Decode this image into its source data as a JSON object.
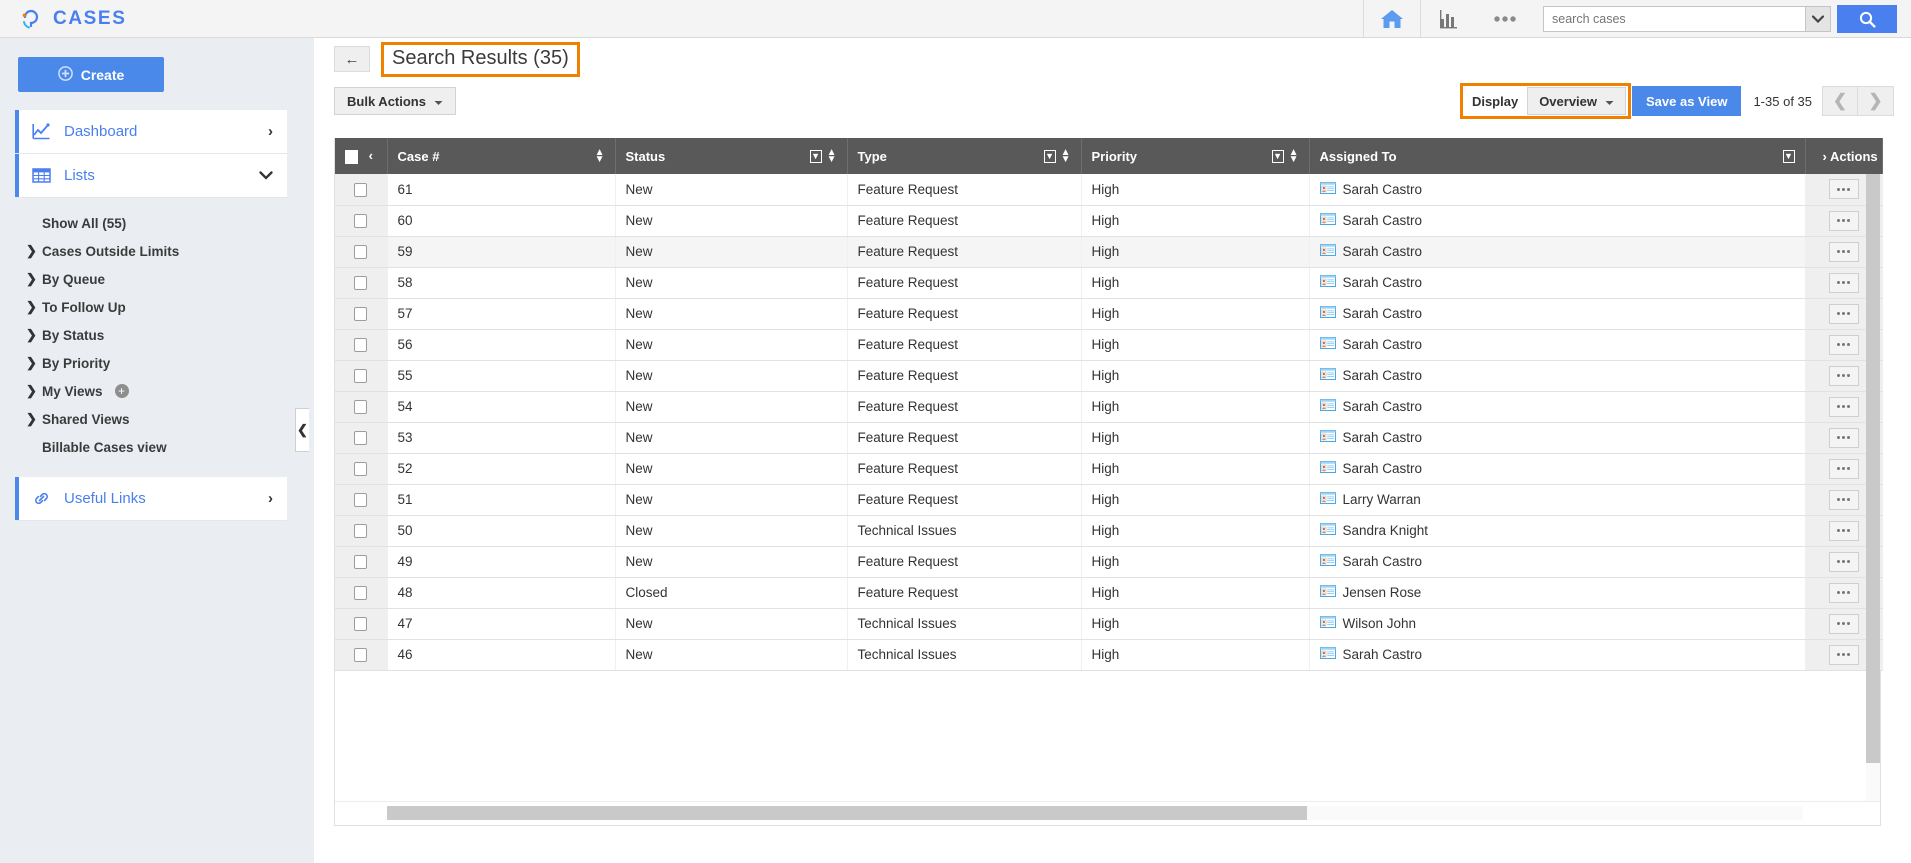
{
  "app": {
    "brand": "CASES",
    "brand_color": "#4a7ff0",
    "accent_color": "#4a89ea",
    "highlight_color": "#f08000"
  },
  "topbar": {
    "home_icon": "home-icon",
    "reports_icon": "bar-chart-icon",
    "more_icon": "more-dots-icon",
    "search_placeholder": "search cases",
    "search_value": "",
    "search_dropdown_icon": "chevron-down-icon",
    "search_button_icon": "search-icon"
  },
  "sidebar": {
    "create_label": "Create",
    "create_icon": "plus-circle-icon",
    "primary": [
      {
        "label": "Dashboard",
        "icon": "chart-line-icon",
        "chevron": "›"
      },
      {
        "label": "Lists",
        "icon": "grid-table-icon",
        "chevron": "⌄"
      }
    ],
    "lists_children": [
      {
        "label": "Show All (55)",
        "type": "leaf"
      },
      {
        "label": "Cases Outside Limits",
        "type": "group"
      },
      {
        "label": "By Queue",
        "type": "group"
      },
      {
        "label": "To Follow Up",
        "type": "group"
      },
      {
        "label": "By Status",
        "type": "group"
      },
      {
        "label": "By Priority",
        "type": "group"
      },
      {
        "label": "My Views",
        "type": "group",
        "badge": "+"
      },
      {
        "label": "Shared Views",
        "type": "group"
      },
      {
        "label": "Billable Cases view",
        "type": "leaf"
      }
    ],
    "useful_links": {
      "label": "Useful Links",
      "icon": "link-icon",
      "chevron": "›"
    },
    "collapse_icon": "chevron-left-icon"
  },
  "page": {
    "back_icon": "back-arrow-icon",
    "title": "Search Results (35)",
    "bulk_actions_label": "Bulk Actions",
    "display_label": "Display",
    "overview_label": "Overview",
    "save_as_view_label": "Save as View",
    "record_range": "1-35 of 35",
    "prev_icon": "chevron-left-icon",
    "next_icon": "chevron-right-icon"
  },
  "table": {
    "select_all_icon": "checkbox-icon",
    "header_chevron": "‹",
    "actions_chevron": "›",
    "columns": [
      {
        "key": "case",
        "label": "Case #",
        "sortable": true,
        "filterable": false
      },
      {
        "key": "status",
        "label": "Status",
        "sortable": true,
        "filterable": true
      },
      {
        "key": "type",
        "label": "Type",
        "sortable": true,
        "filterable": true
      },
      {
        "key": "priority",
        "label": "Priority",
        "sortable": true,
        "filterable": true
      },
      {
        "key": "assigned",
        "label": "Assigned To",
        "sortable": false,
        "filterable": true
      },
      {
        "key": "actions",
        "label": "Actions",
        "sortable": false,
        "filterable": false
      }
    ],
    "rows": [
      {
        "case": "61",
        "status": "New",
        "type": "Feature Request",
        "priority": "High",
        "assigned": "Sarah Castro"
      },
      {
        "case": "60",
        "status": "New",
        "type": "Feature Request",
        "priority": "High",
        "assigned": "Sarah Castro"
      },
      {
        "case": "59",
        "status": "New",
        "type": "Feature Request",
        "priority": "High",
        "assigned": "Sarah Castro"
      },
      {
        "case": "58",
        "status": "New",
        "type": "Feature Request",
        "priority": "High",
        "assigned": "Sarah Castro"
      },
      {
        "case": "57",
        "status": "New",
        "type": "Feature Request",
        "priority": "High",
        "assigned": "Sarah Castro"
      },
      {
        "case": "56",
        "status": "New",
        "type": "Feature Request",
        "priority": "High",
        "assigned": "Sarah Castro"
      },
      {
        "case": "55",
        "status": "New",
        "type": "Feature Request",
        "priority": "High",
        "assigned": "Sarah Castro"
      },
      {
        "case": "54",
        "status": "New",
        "type": "Feature Request",
        "priority": "High",
        "assigned": "Sarah Castro"
      },
      {
        "case": "53",
        "status": "New",
        "type": "Feature Request",
        "priority": "High",
        "assigned": "Sarah Castro"
      },
      {
        "case": "52",
        "status": "New",
        "type": "Feature Request",
        "priority": "High",
        "assigned": "Sarah Castro"
      },
      {
        "case": "51",
        "status": "New",
        "type": "Feature Request",
        "priority": "High",
        "assigned": "Larry Warran"
      },
      {
        "case": "50",
        "status": "New",
        "type": "Technical Issues",
        "priority": "High",
        "assigned": "Sandra Knight"
      },
      {
        "case": "49",
        "status": "New",
        "type": "Feature Request",
        "priority": "High",
        "assigned": "Sarah Castro"
      },
      {
        "case": "48",
        "status": "Closed",
        "type": "Feature Request",
        "priority": "High",
        "assigned": "Jensen Rose"
      },
      {
        "case": "47",
        "status": "New",
        "type": "Technical Issues",
        "priority": "High",
        "assigned": "Wilson John"
      },
      {
        "case": "46",
        "status": "New",
        "type": "Technical Issues",
        "priority": "High",
        "assigned": "Sarah Castro"
      }
    ],
    "row_action_icon": "more-dots-icon",
    "row_checkbox_icon": "checkbox-icon"
  }
}
